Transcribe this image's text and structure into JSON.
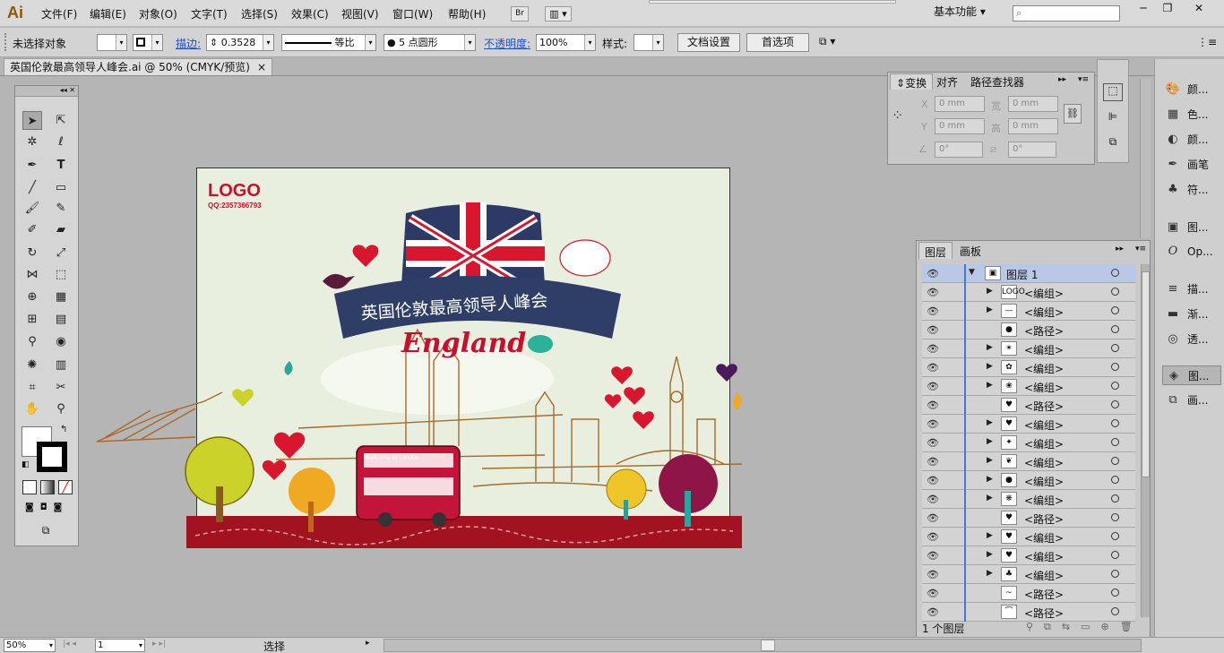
{
  "app": {
    "logo": "Ai",
    "workspace": "基本功能"
  },
  "menu": [
    "文件(F)",
    "编辑(E)",
    "对象(O)",
    "文字(T)",
    "选择(S)",
    "效果(C)",
    "视图(V)",
    "窗口(W)",
    "帮助(H)"
  ],
  "menubar_buttons": {
    "bridge": "Br"
  },
  "window_buttons": {
    "minimize": "─",
    "restore": "❐",
    "close": "✕"
  },
  "control": {
    "selection_status": "未选择对象",
    "stroke_label": "描边:",
    "stroke_value": "0.3528",
    "line_profile": "等比",
    "brush": "5 点圆形",
    "opacity_label": "不透明度:",
    "opacity_value": "100%",
    "style_label": "样式:",
    "doc_setup_button": "文档设置",
    "preferences_button": "首选项"
  },
  "document_tab": {
    "title": "英国伦敦最高领导人峰会.ai @ 50% (CMYK/预览)",
    "close": "×"
  },
  "artboard": {
    "logo_text": "LOGO",
    "qq_text": "QQ:2357366793",
    "banner_text": "英国伦敦最高领导人峰会",
    "script_text": "England",
    "bus_text": "Welcome to London"
  },
  "transform_panel": {
    "tabs": [
      "变换",
      "对齐",
      "路径查找器"
    ],
    "x_label": "X",
    "y_label": "Y",
    "w_label": "宽",
    "h_label": "高",
    "x": "0 mm",
    "y": "0 mm",
    "w": "0 mm",
    "h": "0 mm",
    "rotate": "0°",
    "shear": "0°"
  },
  "dock": [
    {
      "icon": "palette-icon",
      "glyph": "🎨",
      "label": "颜..."
    },
    {
      "icon": "swatches-icon",
      "glyph": "▦",
      "label": "色..."
    },
    {
      "icon": "gradient-guide-icon",
      "glyph": "◐",
      "label": "颜..."
    },
    {
      "icon": "brush-icon",
      "glyph": "✒",
      "label": "画笔"
    },
    {
      "icon": "symbol-icon",
      "glyph": "♣",
      "label": "符..."
    },
    {
      "icon": "graphic-style-icon",
      "glyph": "▣",
      "label": "图..."
    },
    {
      "icon": "opentype-icon",
      "glyph": "O",
      "label": "Op..."
    },
    {
      "icon": "stroke-icon",
      "glyph": "≡",
      "label": "描..."
    },
    {
      "icon": "gradient-icon",
      "glyph": "▬",
      "label": "渐..."
    },
    {
      "icon": "transparency-icon",
      "glyph": "◎",
      "label": "透..."
    },
    {
      "icon": "layers-icon",
      "glyph": "◈",
      "label": "图..."
    },
    {
      "icon": "artboards-icon",
      "glyph": "⧉",
      "label": "画..."
    }
  ],
  "layers_panel": {
    "tabs": [
      "图层",
      "画板"
    ],
    "top_layer": "图层 1",
    "rows": [
      {
        "name": "<编组>",
        "expand": true,
        "thumb": "LOGO"
      },
      {
        "name": "<编组>",
        "expand": true,
        "thumb": "—"
      },
      {
        "name": "<路径>",
        "expand": false,
        "thumb": "●"
      },
      {
        "name": "<编组>",
        "expand": true,
        "thumb": "✶"
      },
      {
        "name": "<编组>",
        "expand": true,
        "thumb": "✿"
      },
      {
        "name": "<编组>",
        "expand": true,
        "thumb": "❀"
      },
      {
        "name": "<路径>",
        "expand": false,
        "thumb": "♥"
      },
      {
        "name": "<编组>",
        "expand": true,
        "thumb": "♥"
      },
      {
        "name": "<编组>",
        "expand": true,
        "thumb": "✦"
      },
      {
        "name": "<编组>",
        "expand": true,
        "thumb": "❦"
      },
      {
        "name": "<编组>",
        "expand": true,
        "thumb": "●"
      },
      {
        "name": "<编组>",
        "expand": true,
        "thumb": "❋"
      },
      {
        "name": "<路径>",
        "expand": false,
        "thumb": "♥"
      },
      {
        "name": "<编组>",
        "expand": true,
        "thumb": "♥"
      },
      {
        "name": "<编组>",
        "expand": true,
        "thumb": "♥"
      },
      {
        "name": "<编组>",
        "expand": true,
        "thumb": "♣"
      },
      {
        "name": "<路径>",
        "expand": false,
        "thumb": "~"
      },
      {
        "name": "<路径>",
        "expand": false,
        "thumb": "⌒"
      }
    ],
    "footer": "1 个图层"
  },
  "status": {
    "zoom": "50%",
    "page": "1",
    "tool": "选择"
  }
}
